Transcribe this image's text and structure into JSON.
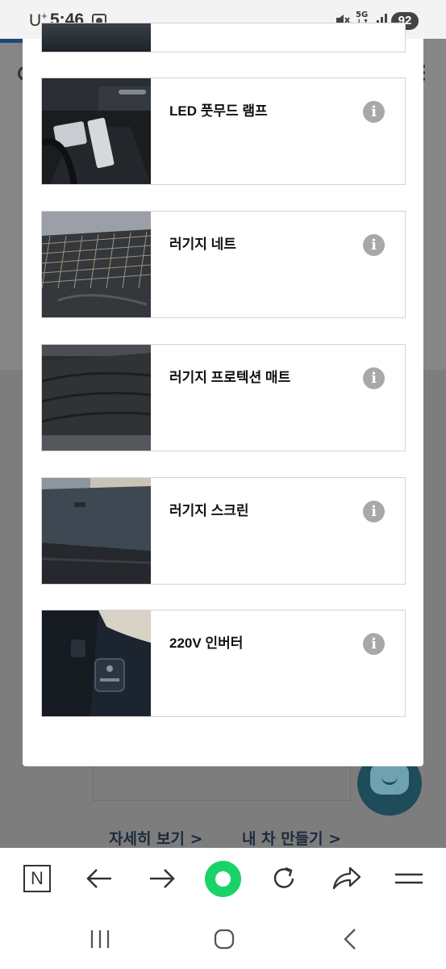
{
  "status_bar": {
    "carrier": "U",
    "carrier_sup": "+",
    "time": "5:46",
    "network": "5G",
    "battery": "92"
  },
  "background_page": {
    "links": [
      "자세히 보기 >",
      "내 차 만들기 >"
    ]
  },
  "accessories": [
    {
      "name": "LED 풋무드 램프",
      "thumb": "foot-mood-lamp-photo"
    },
    {
      "name": "러기지 네트",
      "thumb": "luggage-net-photo"
    },
    {
      "name": "러기지 프로텍션 매트",
      "thumb": "luggage-protection-mat-photo"
    },
    {
      "name": "러기지 스크린",
      "thumb": "luggage-screen-photo"
    },
    {
      "name": "220V 인버터",
      "thumb": "inverter-photo"
    }
  ],
  "info_glyph": "i",
  "toolbar": {
    "naver_logo": "N",
    "icons": [
      "naver-home-icon",
      "back-arrow-icon",
      "forward-arrow-icon",
      "green-dot-icon",
      "refresh-icon",
      "share-icon",
      "menu-icon"
    ]
  },
  "nav_bar": {
    "icons": [
      "recent-apps-icon",
      "home-icon",
      "back-icon"
    ]
  }
}
